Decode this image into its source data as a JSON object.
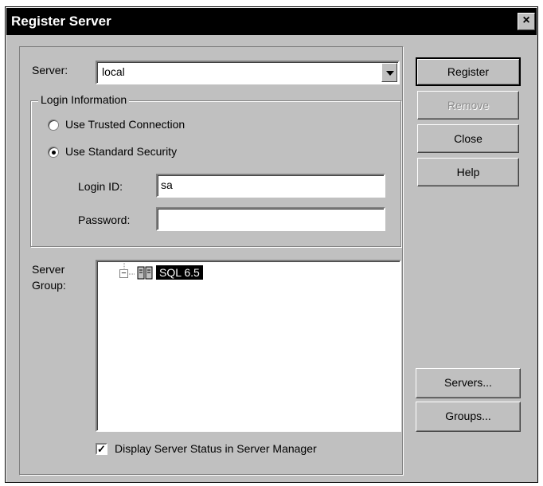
{
  "window": {
    "title": "Register Server",
    "close_glyph": "×"
  },
  "server": {
    "label": "Server:",
    "value": "local"
  },
  "login_info": {
    "legend": "Login Information",
    "trusted_label": "Use Trusted Connection",
    "standard_label": "Use Standard Security",
    "selected": "standard",
    "login_id_label": "Login ID:",
    "login_id_value": "sa",
    "password_label": "Password:",
    "password_value": ""
  },
  "server_group": {
    "label_line1": "Server",
    "label_line2": "Group:",
    "tree": [
      {
        "label": "SQL 6.5",
        "expanded": true,
        "selected": true,
        "icon": "server-group-icon"
      }
    ]
  },
  "display_status": {
    "label": "Display Server Status in Server Manager",
    "checked": true
  },
  "buttons": {
    "register": "Register",
    "remove": "Remove",
    "close": "Close",
    "help": "Help",
    "servers": "Servers...",
    "groups": "Groups..."
  }
}
